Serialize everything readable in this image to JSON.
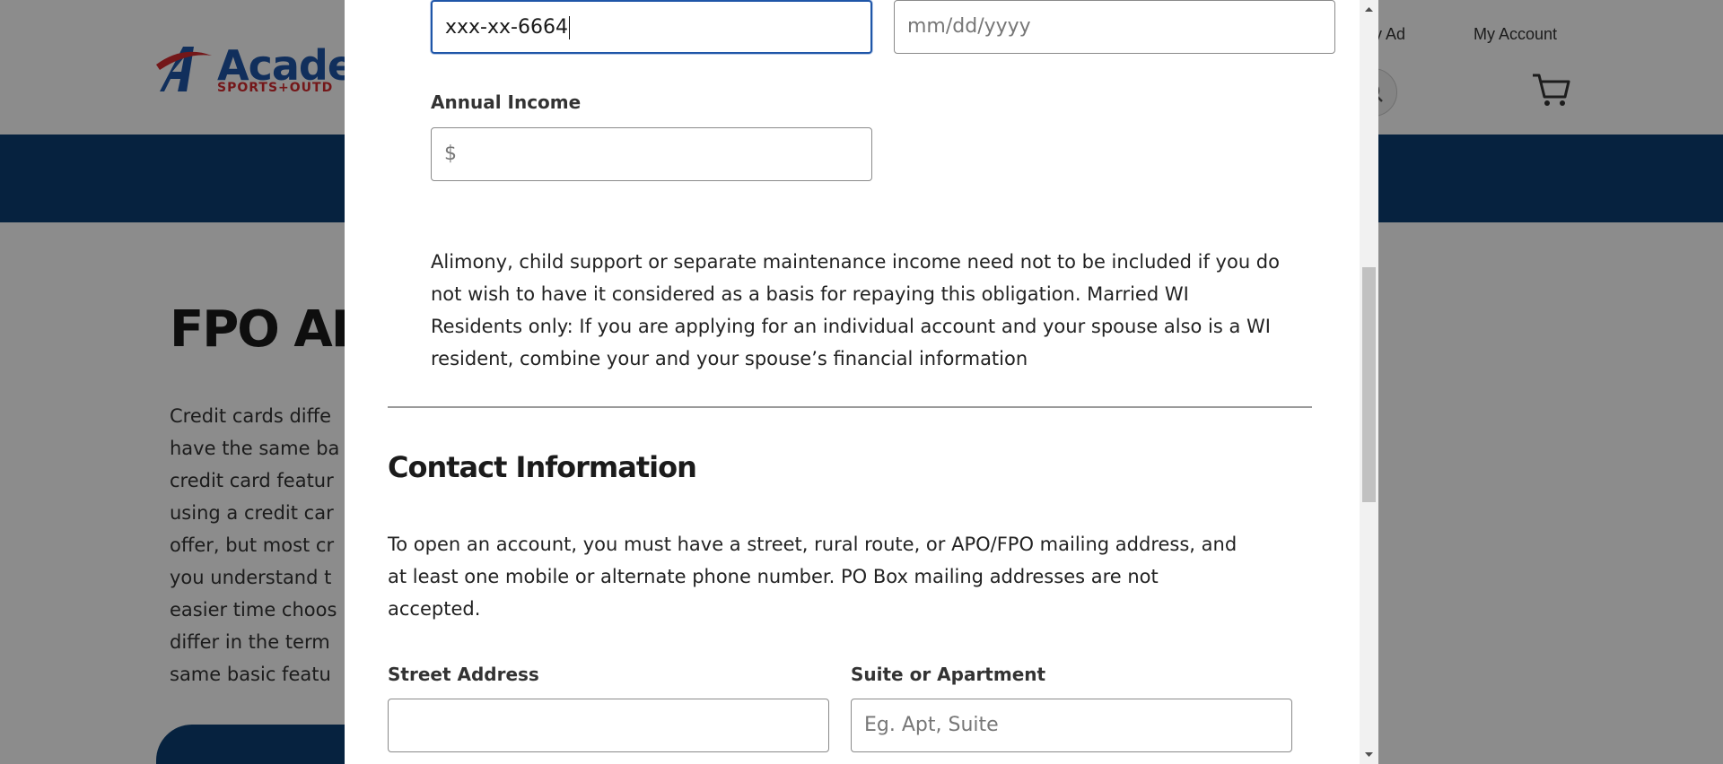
{
  "background_page": {
    "logo": {
      "wordmark": "Acade",
      "tagline": "SPORTS+OUTD"
    },
    "header_links": [
      "ly Ad",
      "My Account"
    ],
    "page_title": "FPO API",
    "body_lines": [
      "Credit cards diffe",
      "have the same ba",
      "credit card featur",
      "using a credit car",
      "offer, but most cr",
      "you understand t",
      "easier time choos",
      "differ in the term",
      "same basic featu"
    ],
    "icons": [
      "search-icon",
      "cart-icon"
    ],
    "colors": {
      "navbar": "#0b3f73",
      "logo_blue": "#1f56a8",
      "logo_red": "#d42a2f"
    }
  },
  "modal": {
    "ssn_field": {
      "value": "xxx-xx-6664"
    },
    "dob_field": {
      "placeholder": "mm/dd/yyyy"
    },
    "annual_income": {
      "label": "Annual Income",
      "prefix": "$"
    },
    "income_disclaimer": [
      "Alimony, child support or separate maintenance income need not to be included if you do",
      "not wish to have it  considered as a basis for repaying this obligation. Married WI",
      "Residents only: If you are applying for an individual account and your spouse also is a WI",
      "resident,  combine your and your spouse’s financial information"
    ],
    "contact_section": {
      "title": "Contact Information",
      "description": [
        "To open an account, you must have a street, rural route, or APO/FPO mailing address, and",
        "at least one mobile or alternate phone number. PO Box mailing addresses are not",
        "accepted."
      ],
      "street_address": {
        "label": "Street Address",
        "value": ""
      },
      "suite": {
        "label": "Suite or Apartment",
        "placeholder": "Eg. Apt, Suite"
      }
    },
    "colors": {
      "focus_border": "#1f56a8",
      "input_border": "#8a8a8a"
    }
  }
}
